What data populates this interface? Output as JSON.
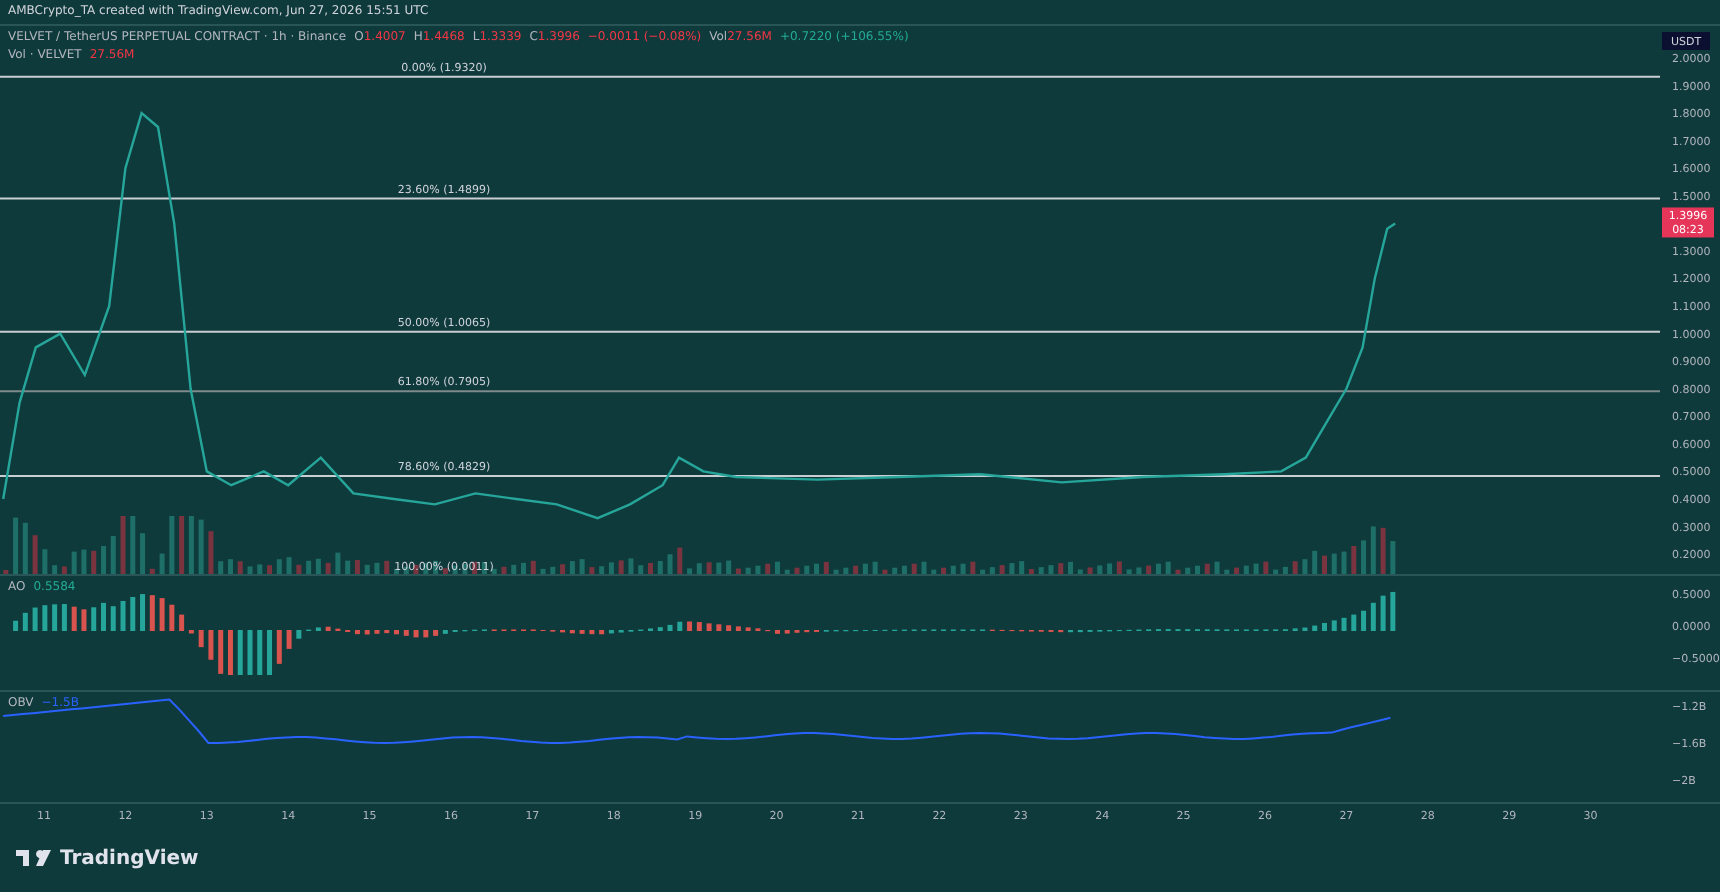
{
  "caption": "AMBCrypto_TA created with TradingView.com, Jun 27, 2026 15:51 UTC",
  "legend": {
    "symbol": "VELVET / TetherUS PERPETUAL CONTRACT · 1h · Binance",
    "ohlc": [
      {
        "key": "O",
        "value": "1.4007"
      },
      {
        "key": "H",
        "value": "1.4468"
      },
      {
        "key": "L",
        "value": "1.3339"
      },
      {
        "key": "C",
        "value": "1.3996"
      }
    ],
    "change": "−0.0011 (−0.08%)",
    "volume_label": "Vol",
    "volume_value": "27.56M",
    "extra_change": "+0.7220 (+106.55%)"
  },
  "volume_legend": {
    "label": "Vol · VELVET",
    "value": "27.56M"
  },
  "price_pane": {
    "currency": "USDT",
    "last_price": "1.3996",
    "countdown": "08:23",
    "axis_labels": [
      "2.0000",
      "1.9000",
      "1.8000",
      "1.7000",
      "1.6000",
      "1.5000",
      "1.3000",
      "1.2000",
      "1.1000",
      "1.0000",
      "0.9000",
      "0.8000",
      "0.7000",
      "0.6000",
      "0.5000",
      "0.4000",
      "0.3000",
      "0.2000"
    ],
    "fib_levels": [
      "0.00% (1.9320)",
      "23.60% (1.4899)",
      "50.00% (1.0065)",
      "61.80% (0.7905)",
      "78.60% (0.4829)",
      "100.00% (0.0011)"
    ]
  },
  "ao_pane": {
    "label": "AO",
    "value": "0.5584",
    "axis_labels": [
      "0.5000",
      "0.0000",
      "−0.5000"
    ]
  },
  "obv_pane": {
    "label": "OBV",
    "value": "−1.5B",
    "axis_labels": [
      "−1.2B",
      "−1.6B",
      "−2B"
    ]
  },
  "time_axis": [
    "11",
    "12",
    "13",
    "14",
    "15",
    "16",
    "17",
    "18",
    "19",
    "20",
    "21",
    "22",
    "23",
    "24",
    "25",
    "26",
    "27",
    "28",
    "29",
    "30"
  ],
  "footer": {
    "brand": "TradingView"
  }
}
